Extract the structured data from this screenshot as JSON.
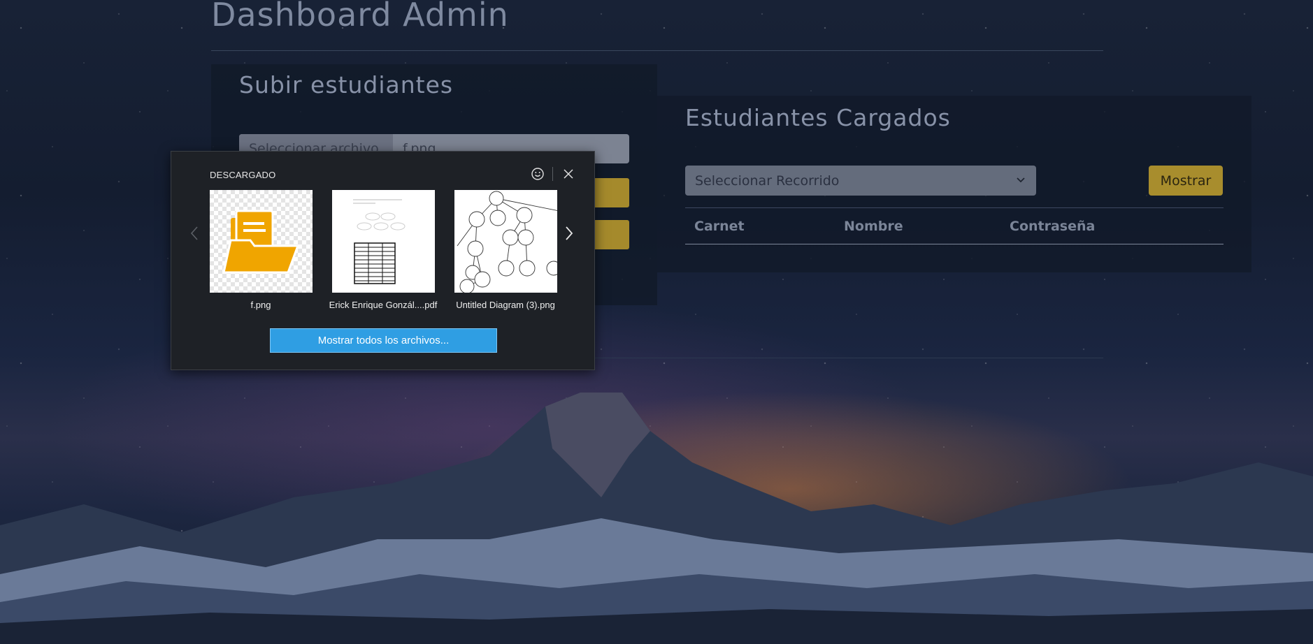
{
  "page": {
    "title": "Dashboard Admin"
  },
  "upload_panel": {
    "title": "Subir estudiantes",
    "file_button_label": "Seleccionar archivo",
    "file_name": "f.png"
  },
  "students_panel": {
    "title": "Estudiantes Cargados",
    "select_value": "Seleccionar Recorrido",
    "show_button": "Mostrar",
    "columns": [
      "Carnet",
      "Nombre",
      "Contraseña"
    ]
  },
  "download_popup": {
    "header": "DESCARGADO",
    "files": [
      {
        "name": "f.png",
        "icon": "folder-icon"
      },
      {
        "name": "Erick Enrique Gonzál....pdf",
        "icon": "document-thumbnail"
      },
      {
        "name": "Untitled Diagram (3).png",
        "icon": "diagram-thumbnail"
      }
    ],
    "show_all_button": "Mostrar todos los archivos..."
  },
  "colors": {
    "accent_gold": "#a88d2d",
    "popup_button_blue": "#2f9ee3",
    "popup_background": "#1e2126"
  }
}
